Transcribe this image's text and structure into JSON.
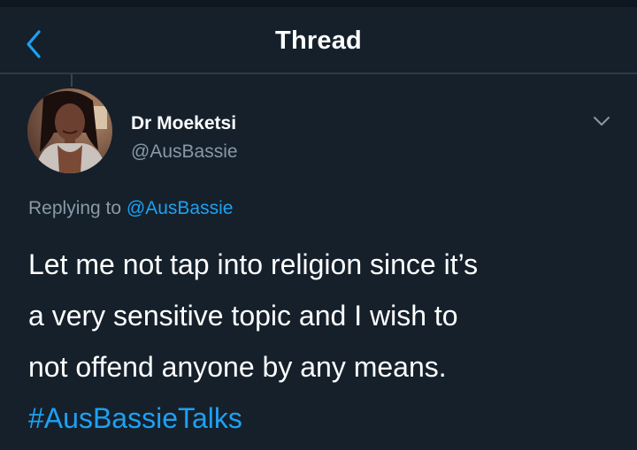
{
  "header": {
    "title": "Thread",
    "back_icon": "chevron-left-icon"
  },
  "tweet": {
    "author": {
      "display_name": "Dr Moeketsi",
      "handle": "@AusBassie"
    },
    "menu_icon": "chevron-down-icon",
    "replying_prefix": "Replying to ",
    "replying_to": "@AusBassie",
    "text_lines": [
      "Let me not tap into religion since it’s",
      "a very sensitive topic and I wish to",
      "not offend anyone by any means."
    ],
    "hashtag": "#AusBassieTalks"
  },
  "colors": {
    "background": "#15202b",
    "accent": "#1da1f2",
    "secondary_text": "#8899a6"
  }
}
